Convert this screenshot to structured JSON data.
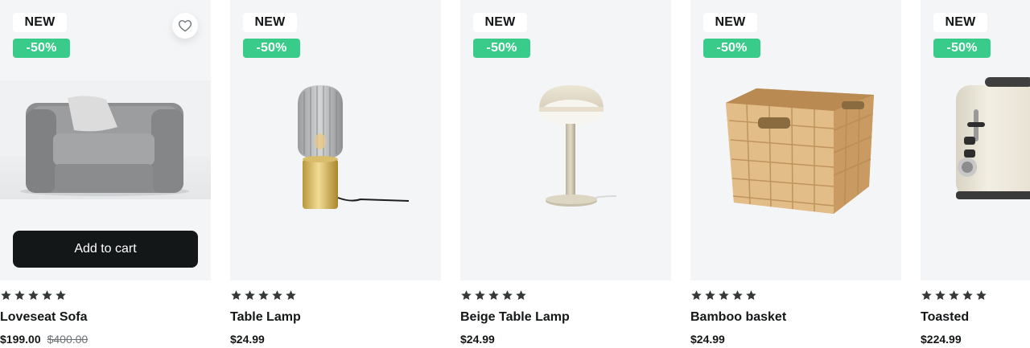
{
  "colors": {
    "card_bg": "#f3f5f7",
    "badge_sale": "#38cb89",
    "button": "#141718",
    "star": "#343839"
  },
  "products": [
    {
      "badge_new": "NEW",
      "badge_sale": "-50%",
      "name": "Loveseat Sofa",
      "price": "$199.00",
      "old_price": "$400.00",
      "rating": 5,
      "cart_label": "Add to cart",
      "wishlist_icon": "heart-icon"
    },
    {
      "badge_new": "NEW",
      "badge_sale": "-50%",
      "name": "Table Lamp",
      "price": "$24.99",
      "rating": 5
    },
    {
      "badge_new": "NEW",
      "badge_sale": "-50%",
      "name": "Beige Table Lamp",
      "price": "$24.99",
      "rating": 5
    },
    {
      "badge_new": "NEW",
      "badge_sale": "-50%",
      "name": "Bamboo basket",
      "price": "$24.99",
      "rating": 5
    },
    {
      "badge_new": "NEW",
      "badge_sale": "-50%",
      "name": "Toasted",
      "price": "$224.99",
      "rating": 5
    }
  ]
}
